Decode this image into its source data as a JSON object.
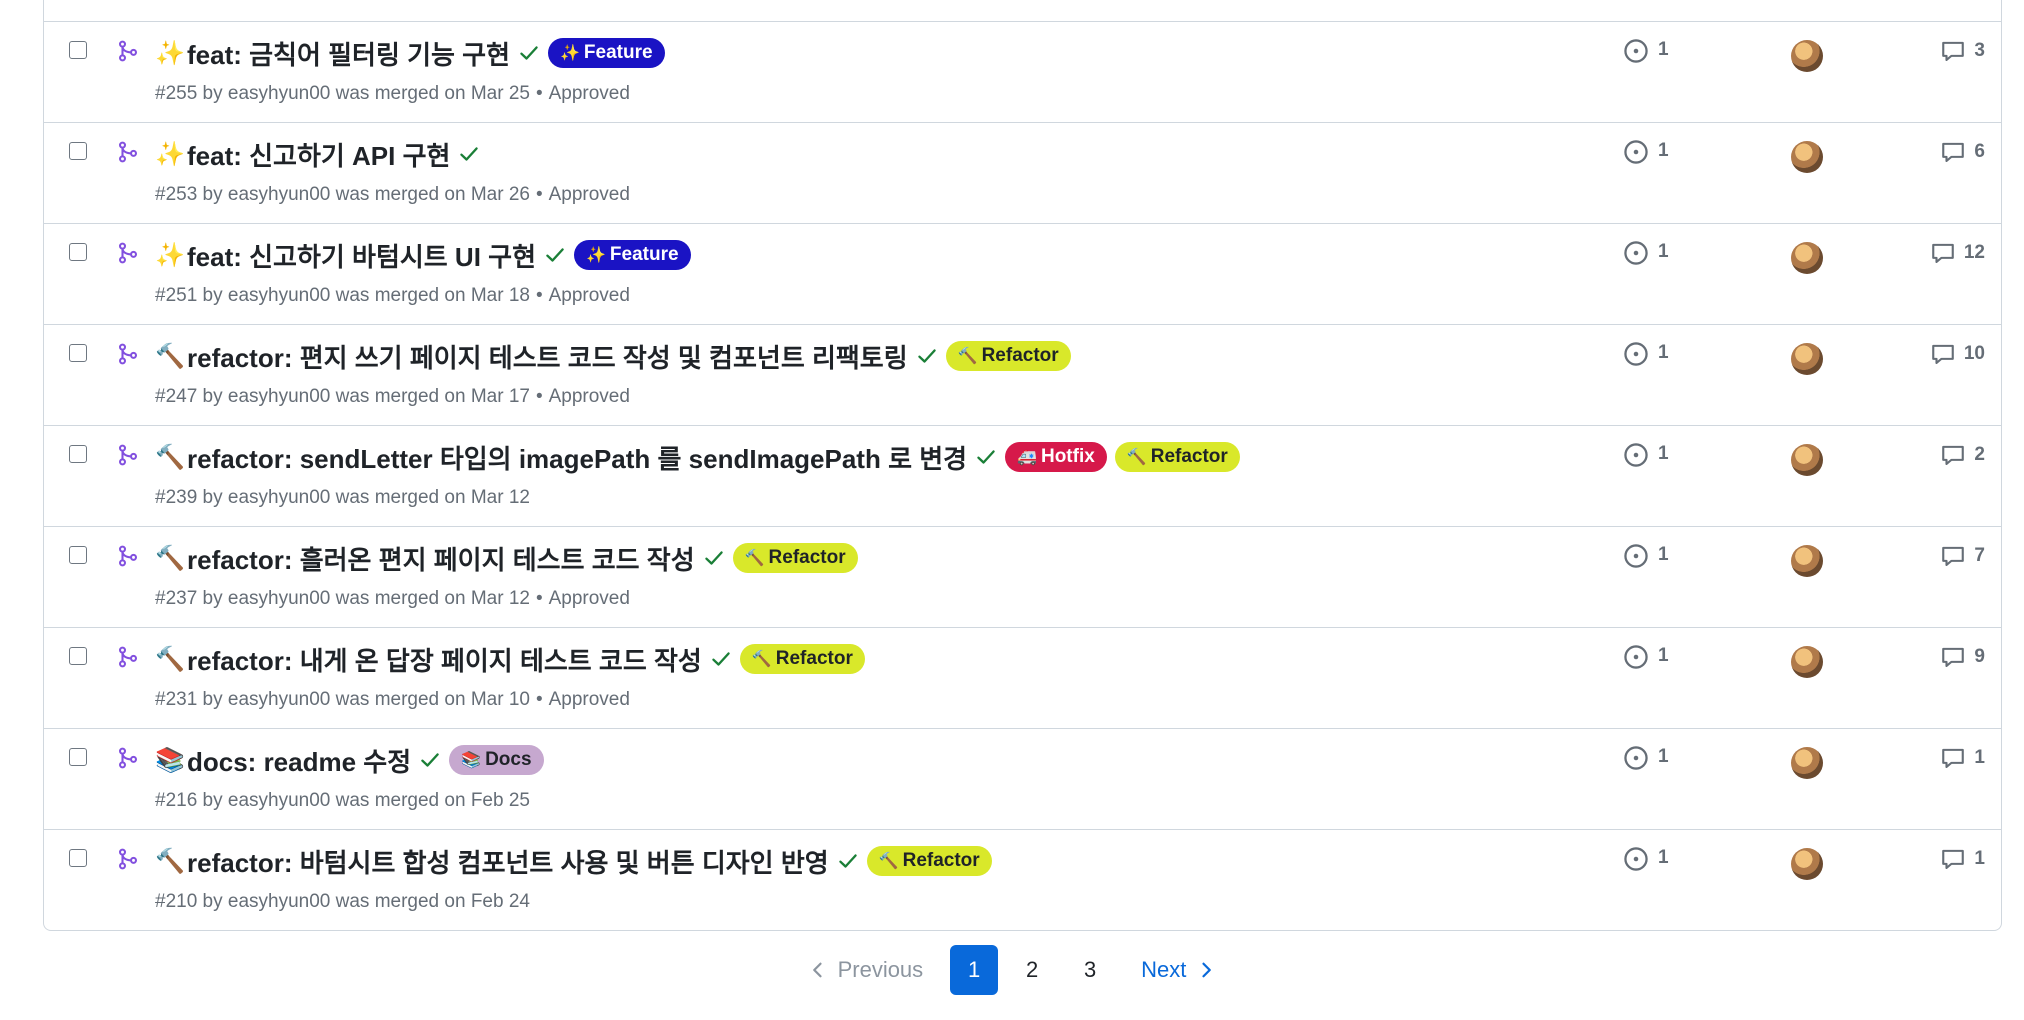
{
  "rows": [
    {
      "emoji": "✨",
      "title": "feat: 금칙어 필터링 기능 구현",
      "labels": [
        {
          "emoji": "✨",
          "text": "Feature",
          "bg": "#1a13c4",
          "fg": "#ffffff"
        }
      ],
      "meta": "#255 by easyhyun00 was merged on Mar 25",
      "review": "Approved",
      "issues": "1",
      "comments": "3"
    },
    {
      "emoji": "✨",
      "title": "feat: 신고하기 API 구현",
      "labels": [],
      "meta": "#253 by easyhyun00 was merged on Mar 26",
      "review": "Approved",
      "issues": "1",
      "comments": "6"
    },
    {
      "emoji": "✨",
      "title": "feat: 신고하기 바텀시트 UI 구현",
      "labels": [
        {
          "emoji": "✨",
          "text": "Feature",
          "bg": "#1a13c4",
          "fg": "#ffffff"
        }
      ],
      "meta": "#251 by easyhyun00 was merged on Mar 18",
      "review": "Approved",
      "issues": "1",
      "comments": "12"
    },
    {
      "emoji": "🔨",
      "title": "refactor: 편지 쓰기 페이지 테스트 코드 작성 및 컴포넌트 리팩토링",
      "labels": [
        {
          "emoji": "🔨",
          "text": "Refactor",
          "bg": "#d9e82a",
          "fg": "#1f2328"
        }
      ],
      "meta": "#247 by easyhyun00 was merged on Mar 17",
      "review": "Approved",
      "issues": "1",
      "comments": "10"
    },
    {
      "emoji": "🔨",
      "title": "refactor: sendLetter 타입의 imagePath 를 sendImagePath 로 변경",
      "labels": [
        {
          "emoji": "🚑",
          "text": "Hotfix",
          "bg": "#d6194a",
          "fg": "#ffffff"
        },
        {
          "emoji": "🔨",
          "text": "Refactor",
          "bg": "#d9e82a",
          "fg": "#1f2328"
        }
      ],
      "meta": "#239 by easyhyun00 was merged on Mar 12",
      "review": "",
      "issues": "1",
      "comments": "2"
    },
    {
      "emoji": "🔨",
      "title": "refactor: 흘러온 편지 페이지 테스트 코드 작성",
      "labels": [
        {
          "emoji": "🔨",
          "text": "Refactor",
          "bg": "#d9e82a",
          "fg": "#1f2328"
        }
      ],
      "meta": "#237 by easyhyun00 was merged on Mar 12",
      "review": "Approved",
      "issues": "1",
      "comments": "7"
    },
    {
      "emoji": "🔨",
      "title": "refactor: 내게 온 답장 페이지 테스트 코드 작성",
      "labels": [
        {
          "emoji": "🔨",
          "text": "Refactor",
          "bg": "#d9e82a",
          "fg": "#1f2328"
        }
      ],
      "meta": "#231 by easyhyun00 was merged on Mar 10",
      "review": "Approved",
      "issues": "1",
      "comments": "9"
    },
    {
      "emoji": "📚",
      "title": "docs: readme 수정",
      "labels": [
        {
          "emoji": "📚",
          "text": "Docs",
          "bg": "#c6a8cf",
          "fg": "#1f2328"
        }
      ],
      "meta": "#216 by easyhyun00 was merged on Feb 25",
      "review": "",
      "issues": "1",
      "comments": "1"
    },
    {
      "emoji": "🔨",
      "title": "refactor: 바텀시트 합성 컴포넌트 사용 및 버튼 디자인 반영",
      "labels": [
        {
          "emoji": "🔨",
          "text": "Refactor",
          "bg": "#d9e82a",
          "fg": "#1f2328"
        }
      ],
      "meta": "#210 by easyhyun00 was merged on Feb 24",
      "review": "",
      "issues": "1",
      "comments": "1"
    }
  ],
  "pagination": {
    "previous": "Previous",
    "pages": [
      "1",
      "2",
      "3"
    ],
    "current": "1",
    "next": "Next"
  },
  "colors": {
    "merged_icon": "#8250df",
    "check": "#1a7f37",
    "accent": "#0969da"
  }
}
